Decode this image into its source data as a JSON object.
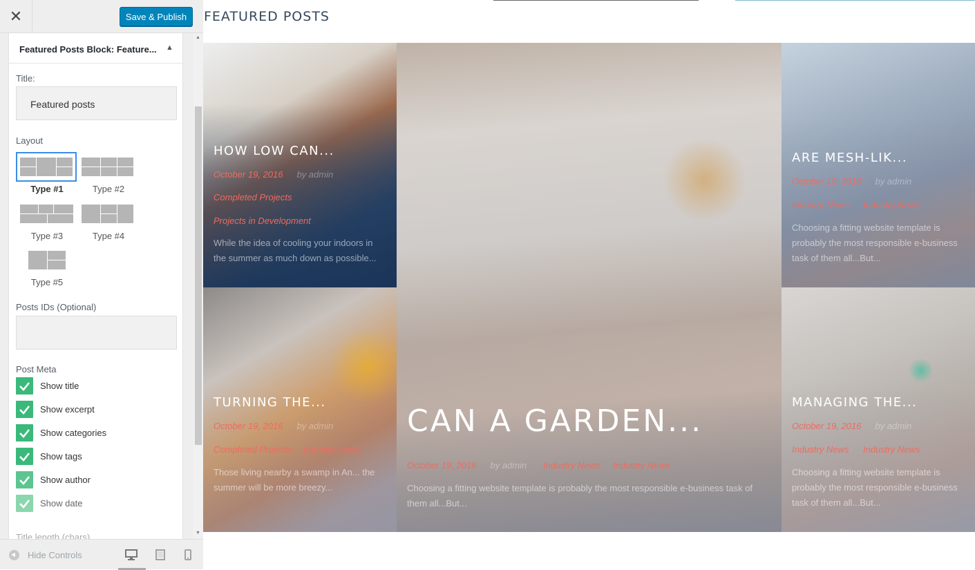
{
  "header": {
    "save_label": "Save & Publish"
  },
  "widget": {
    "title": "Featured Posts Block: Feature...",
    "title_label": "Title:",
    "title_value": "Featured posts",
    "layout_label": "Layout",
    "layouts": [
      "Type #1",
      "Type #2",
      "Type #3",
      "Type #4",
      "Type #5"
    ],
    "selected_layout": "Type #1",
    "ids_label": "Posts IDs (Optional)",
    "ids_value": "",
    "meta_label": "Post Meta",
    "meta_options": [
      "Show title",
      "Show excerpt",
      "Show categories",
      "Show tags",
      "Show author",
      "Show date"
    ],
    "next_label": "Title length (chars)"
  },
  "footer": {
    "hide_controls": "Hide Controls"
  },
  "preview": {
    "section_title": "FEATURED POSTS",
    "posts": [
      {
        "title": "HOW LOW CAN...",
        "date": "October 19, 2016",
        "author": "by admin",
        "cats": [
          "Completed Projects",
          "Projects in Development"
        ],
        "excerpt": "While the idea of cooling your indoors in the summer as much down as possible..."
      },
      {
        "title": "CAN A GARDEN...",
        "date": "October 19, 2016",
        "author": "by admin",
        "cats": [
          "Industry News",
          "Industry News"
        ],
        "excerpt": "Choosing a fitting website template is probably the most responsible e-business task of them all...But..."
      },
      {
        "title": "ARE MESH-LIK...",
        "date": "October 19, 2016",
        "author": "by admin",
        "cats": [
          "Industry News",
          "Industry News"
        ],
        "excerpt": "Choosing a fitting website template is probably the most responsible e-business task of them all...But..."
      },
      {
        "title": "TURNING THE...",
        "date": "October 19, 2016",
        "author": "by admin",
        "cats": [
          "Completed Projects",
          "Industry News"
        ],
        "excerpt": "Those living nearby a swamp in An... the summer will be more breezy..."
      },
      {
        "title": "MANAGING THE...",
        "date": "October 19, 2016",
        "author": "by admin",
        "cats": [
          "Industry News",
          "Industry News"
        ],
        "excerpt": "Choosing a fitting website template is probably the most responsible e-business task of them all...But..."
      }
    ]
  }
}
